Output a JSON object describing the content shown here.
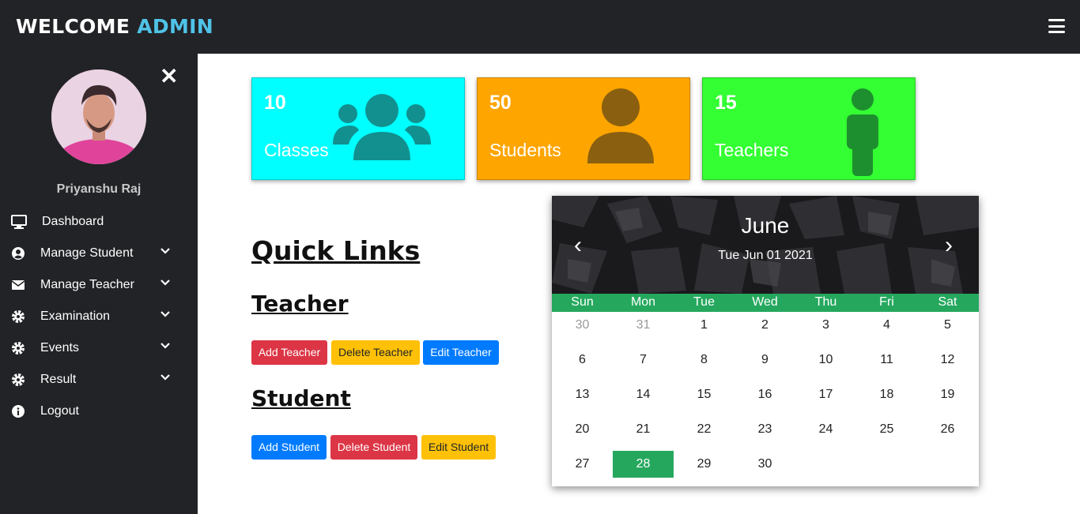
{
  "header": {
    "brand_prefix": "WELCOME",
    "brand_accent": "ADMIN",
    "menu_icon": "hamburger-icon"
  },
  "sidebar": {
    "username": "Priyanshu Raj",
    "close_icon": "close-icon",
    "items": [
      {
        "label": "Dashboard",
        "icon": "monitor-icon"
      },
      {
        "label": "Manage Student",
        "icon": "user-circle-icon"
      },
      {
        "label": "Manage Teacher",
        "icon": "envelope-icon"
      },
      {
        "label": "Examination",
        "icon": "gear-icon"
      },
      {
        "label": "Events",
        "icon": "gear-icon"
      },
      {
        "label": "Result",
        "icon": "gear-icon"
      },
      {
        "label": "Logout",
        "icon": "info-icon"
      }
    ]
  },
  "cards": [
    {
      "count": "10",
      "label": "Classes",
      "color": "#00ffff",
      "icon": "users-group-icon"
    },
    {
      "count": "50",
      "label": "Students",
      "color": "#ffa500",
      "icon": "user-icon"
    },
    {
      "count": "15",
      "label": "Teachers",
      "color": "#33ff33",
      "icon": "standing-person-icon"
    }
  ],
  "quick_links": {
    "title": "Quick Links",
    "teacher": {
      "heading": "Teacher",
      "add": "Add Teacher",
      "delete": "Delete Teacher",
      "edit": "Edit Teacher"
    },
    "student": {
      "heading": "Student",
      "add": "Add Student",
      "delete": "Delete Student",
      "edit": "Edit Student"
    }
  },
  "calendar": {
    "month": "June",
    "date_text": "Tue Jun 01 2021",
    "prev": "‹",
    "next": "›",
    "weekdays": [
      "Sun",
      "Mon",
      "Tue",
      "Wed",
      "Thu",
      "Fri",
      "Sat"
    ],
    "weeks": [
      [
        "30",
        "31",
        "1",
        "2",
        "3",
        "4",
        "5"
      ],
      [
        "6",
        "7",
        "8",
        "9",
        "10",
        "11",
        "12"
      ],
      [
        "13",
        "14",
        "15",
        "16",
        "17",
        "18",
        "19"
      ],
      [
        "20",
        "21",
        "22",
        "23",
        "24",
        "25",
        "26"
      ],
      [
        "27",
        "28",
        "29",
        "30",
        "",
        "",
        ""
      ]
    ],
    "muted_days": [
      "30",
      "31"
    ],
    "today": "28",
    "accent_color": "#25a85e"
  }
}
